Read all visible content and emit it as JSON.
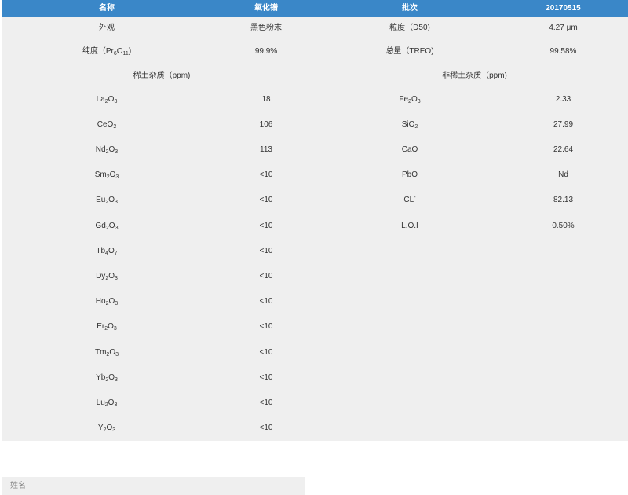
{
  "header": {
    "name_label": "名称",
    "name_value": "氧化镨",
    "batch_label": "批次",
    "batch_value": "20170515"
  },
  "specs": {
    "appearance_label": "外观",
    "appearance_value": "黑色粉末",
    "particle_label": "粒度（D50)",
    "particle_value": "4.27 μm",
    "purity_label_prefix": "纯度（Pr",
    "purity_label_sub1": "6",
    "purity_label_mid": "O",
    "purity_label_sub2": "11",
    "purity_label_suffix": ")",
    "purity_value": "99.9%",
    "treo_label": "总量（TREO)",
    "treo_value": "99.58%"
  },
  "sections": {
    "rare_earth_title": "稀土杂质（ppm)",
    "non_rare_earth_title": "非稀土杂质（ppm)"
  },
  "rare_earth_impurities": [
    {
      "el": "La",
      "n1": "2",
      "o": "O",
      "n2": "3",
      "value": "18"
    },
    {
      "el": "CeO",
      "n1": "2",
      "o": "",
      "n2": "",
      "value": "106"
    },
    {
      "el": "Nd",
      "n1": "2",
      "o": "O",
      "n2": "3",
      "value": "113"
    },
    {
      "el": "Sm",
      "n1": "2",
      "o": "O",
      "n2": "3",
      "value": "<10"
    },
    {
      "el": "Eu",
      "n1": "2",
      "o": "O",
      "n2": "3",
      "value": "<10"
    },
    {
      "el": "Gd",
      "n1": "2",
      "o": "O",
      "n2": "3",
      "value": "<10"
    },
    {
      "el": "Tb",
      "n1": "4",
      "o": "O",
      "n2": "7",
      "value": "<10"
    },
    {
      "el": "Dy",
      "n1": "2",
      "o": "O",
      "n2": "3",
      "value": "<10"
    },
    {
      "el": "Ho",
      "n1": "2",
      "o": "O",
      "n2": "3",
      "value": "<10"
    },
    {
      "el": "Er",
      "n1": "2",
      "o": "O",
      "n2": "3",
      "value": "<10"
    },
    {
      "el": "Tm",
      "n1": "2",
      "o": "O",
      "n2": "3",
      "value": "<10"
    },
    {
      "el": "Yb",
      "n1": "2",
      "o": "O",
      "n2": "3",
      "value": "<10"
    },
    {
      "el": "Lu",
      "n1": "2",
      "o": "O",
      "n2": "3",
      "value": "<10"
    },
    {
      "el": "Y",
      "n1": "2",
      "o": "O",
      "n2": "3",
      "value": "<10"
    }
  ],
  "non_rare_earth_impurities": [
    {
      "el": "Fe",
      "n1": "2",
      "o": "O",
      "n2": "3",
      "sup": "",
      "value": "2.33"
    },
    {
      "el": "SiO",
      "n1": "2",
      "o": "",
      "n2": "",
      "sup": "",
      "value": "27.99"
    },
    {
      "el": "CaO",
      "n1": "",
      "o": "",
      "n2": "",
      "sup": "",
      "value": "22.64"
    },
    {
      "el": "PbO",
      "n1": "",
      "o": "",
      "n2": "",
      "sup": "",
      "value": "Nd"
    },
    {
      "el": "CL",
      "n1": "",
      "o": "",
      "n2": "",
      "sup": "-",
      "value": "82.13"
    },
    {
      "el": "L.O.I",
      "n1": "",
      "o": "",
      "n2": "",
      "sup": "",
      "value": "0.50%"
    }
  ],
  "form": {
    "name_placeholder": "姓名",
    "name_value": ""
  },
  "colors": {
    "header_bg": "#3a87c8",
    "table_bg": "#efefef"
  }
}
